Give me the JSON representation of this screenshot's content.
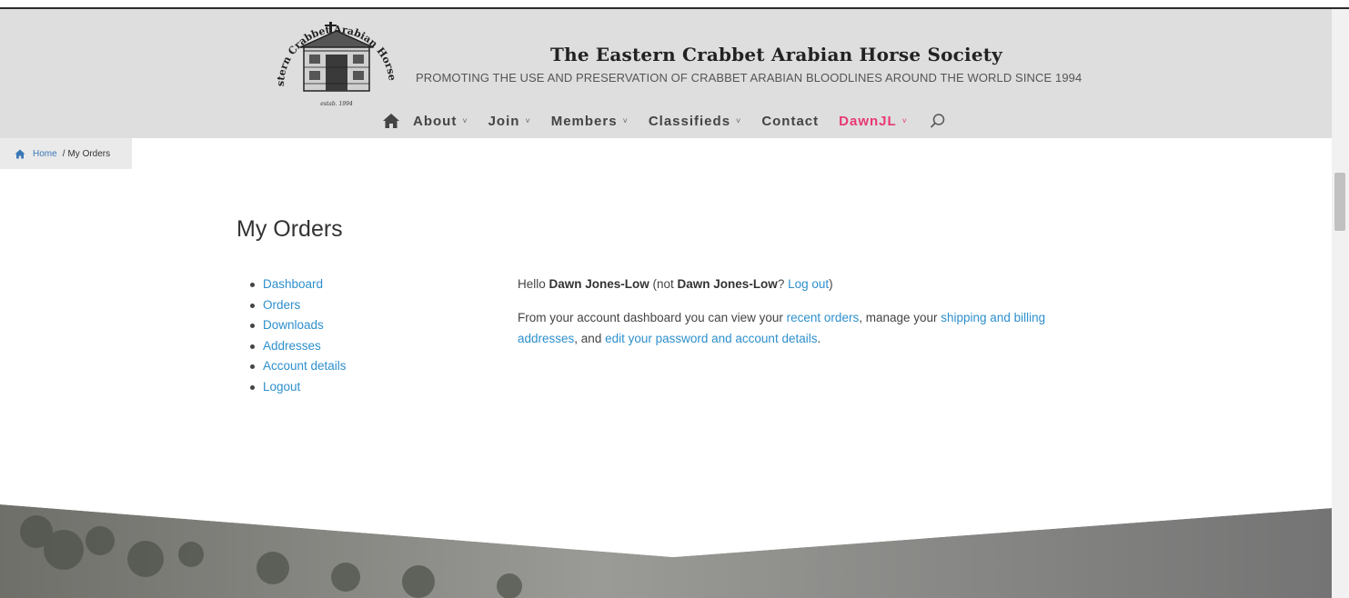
{
  "site": {
    "title": "The Eastern Crabbet Arabian Horse Society",
    "tagline": "PROMOTING THE USE AND PRESERVATION OF CRABBET ARABIAN BLOODLINES AROUND THE WORLD SINCE 1994",
    "logo_arc_text": "The Eastern Crabbet Arabian Horse Society",
    "logo_estab": "estab. 1994"
  },
  "nav": {
    "home_icon": "home-icon",
    "items": [
      {
        "label": "About",
        "has_dropdown": true
      },
      {
        "label": "Join",
        "has_dropdown": true
      },
      {
        "label": "Members",
        "has_dropdown": true
      },
      {
        "label": "Classifieds",
        "has_dropdown": true
      },
      {
        "label": "Contact",
        "has_dropdown": false
      },
      {
        "label": "DawnJL",
        "has_dropdown": true
      }
    ],
    "chevron": "˅",
    "search_icon": "search-icon",
    "user_color": "#e83874"
  },
  "breadcrumb": {
    "home_label": "Home",
    "separator": "/",
    "current": "My Orders"
  },
  "page": {
    "title": "My Orders"
  },
  "account_nav": {
    "items": [
      "Dashboard",
      "Orders",
      "Downloads",
      "Addresses",
      "Account details",
      "Logout"
    ]
  },
  "dashboard": {
    "hello_prefix": "Hello ",
    "user_name": "Dawn Jones-Low",
    "not_prefix": " (not ",
    "not_name": "Dawn Jones-Low",
    "question": "? ",
    "logout_link": "Log out",
    "close_paren": ")",
    "intro_1": "From your account dashboard you can view your ",
    "recent_orders_link": "recent orders",
    "intro_2": ", manage your ",
    "addresses_link": "shipping and billing addresses",
    "intro_3": ", and ",
    "account_link": "edit your password and account details",
    "intro_4": "."
  },
  "colors": {
    "header_bg": "#dedede",
    "link": "#2d8fcd",
    "user_accent": "#e83874"
  }
}
